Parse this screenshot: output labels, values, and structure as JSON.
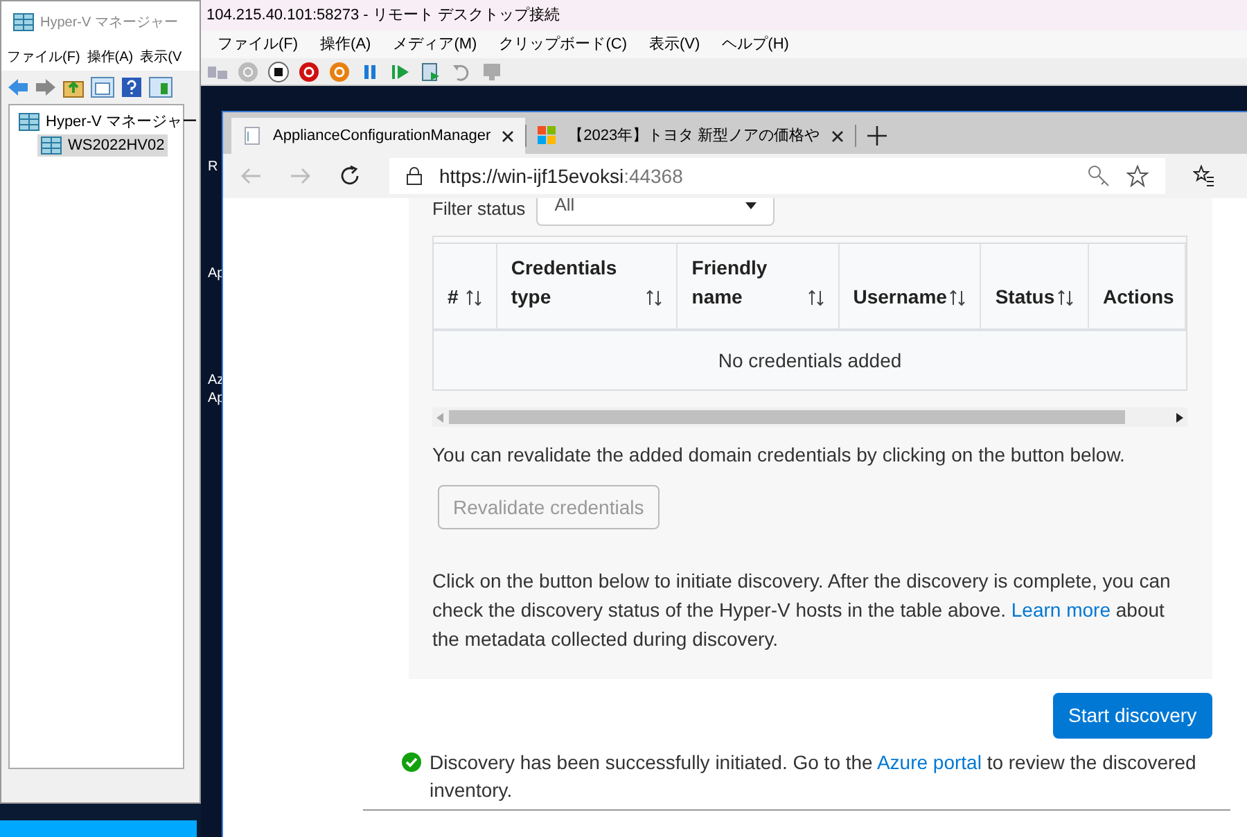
{
  "hyperv_window": {
    "title": "Hyper-V マネージャー",
    "menu": [
      "ファイル(F)",
      "操作(A)",
      "表示(V"
    ],
    "tree": [
      {
        "label": "Hyper-V マネージャー",
        "selected": false,
        "children": [
          {
            "label": "WS2022HV02",
            "selected": true
          }
        ]
      }
    ]
  },
  "rdp_window": {
    "title": "104.215.40.101:58273 - リモート デスクトップ接続",
    "menu": [
      "ファイル(F)",
      "操作(A)",
      "メディア(M)",
      "クリップボード(C)",
      "表示(V)",
      "ヘルプ(H)"
    ]
  },
  "desktop_icons": [
    {
      "label": "R"
    },
    {
      "label": "Ap"
    },
    {
      "label": "Az\nAp"
    }
  ],
  "browser": {
    "tabs": [
      {
        "label": "ApplianceConfigurationManager",
        "selected": true
      },
      {
        "label": "【2023年】トヨタ 新型ノアの価格や",
        "selected": false
      }
    ],
    "url_host": "https://win-ijf15evoksi",
    "url_port": ":44368"
  },
  "page": {
    "filter": {
      "label": "Filter status",
      "value": "All"
    },
    "table": {
      "columns": [
        {
          "label": "#",
          "sortable": true
        },
        {
          "label": "Credentials type",
          "sortable": true
        },
        {
          "label": "Friendly name",
          "sortable": true
        },
        {
          "label": "Username",
          "sortable": true
        },
        {
          "label": "Status",
          "sortable": true
        },
        {
          "label": "Actions",
          "sortable": false
        }
      ],
      "empty_text": "No credentials added"
    },
    "revalidate_text": "You can revalidate the added domain credentials by clicking on the button below.",
    "revalidate_button": {
      "label": "Revalidate credentials",
      "disabled": true
    },
    "discovery_text": [
      "Click on the button below to initiate discovery. After the discovery is complete, you can check the discovery status of the Hyper-V hosts in the table above. ",
      "Learn more",
      " about the metadata collected during discovery."
    ],
    "start_button": {
      "label": "Start discovery",
      "disabled": false
    },
    "success_message": [
      "Discovery has been successfully initiated. Go to the ",
      "Azure portal",
      " to review the discovered inventory."
    ]
  }
}
